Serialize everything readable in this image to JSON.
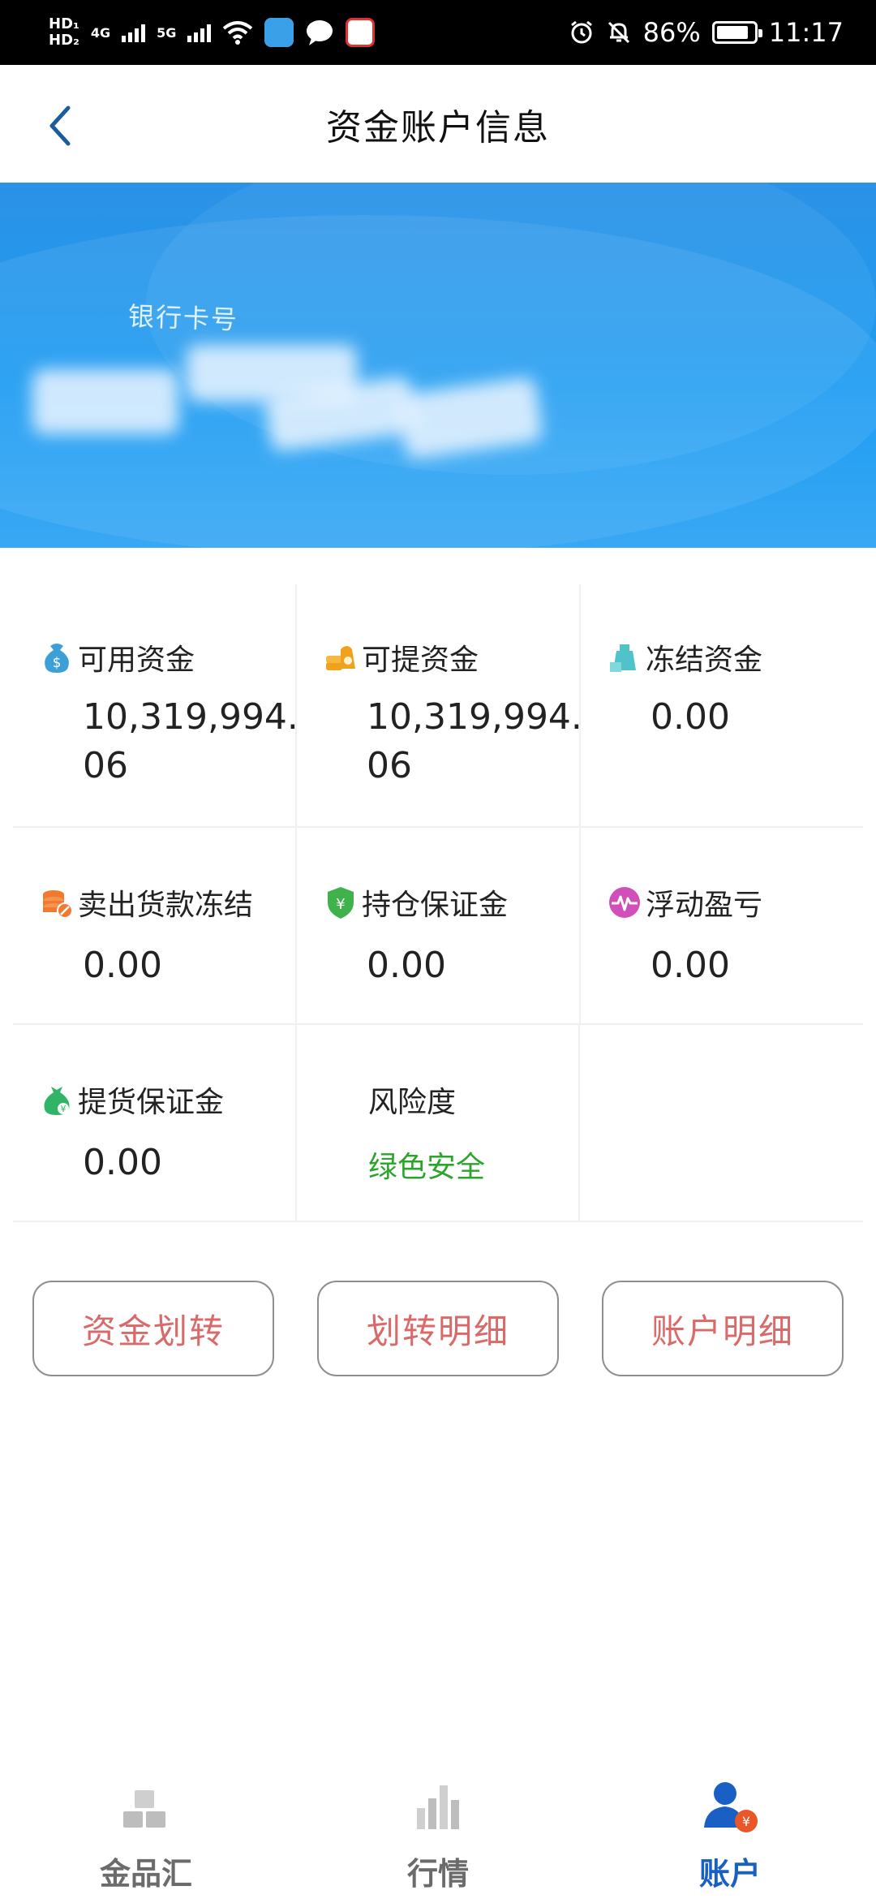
{
  "status_bar": {
    "hd1": "HD₁",
    "hd2": "HD₂",
    "net1": "4G",
    "net2": "5G",
    "battery": "86%",
    "time": "11:17"
  },
  "header": {
    "title": "资金账户信息"
  },
  "banner": {
    "bank_label": "银行卡号"
  },
  "funds": {
    "available": {
      "label": "可用资金",
      "value": "10,319,994.06",
      "icon": "money-bag-icon"
    },
    "withdrawable": {
      "label": "可提资金",
      "value": "10,319,994.06",
      "icon": "gold-coins-icon"
    },
    "frozen": {
      "label": "冻结资金",
      "value": "0.00",
      "icon": "frozen-money-icon"
    },
    "sale_frozen": {
      "label": "卖出货款冻结",
      "value": "0.00",
      "icon": "coin-stack-icon"
    },
    "position_margin": {
      "label": "持仓保证金",
      "value": "0.00",
      "icon": "shield-yen-icon"
    },
    "floating_pl": {
      "label": "浮动盈亏",
      "value": "0.00",
      "icon": "pulse-icon"
    },
    "delivery_margin": {
      "label": "提货保证金",
      "value": "0.00",
      "icon": "delivery-bag-icon"
    },
    "risk": {
      "label": "风险度",
      "value": "绿色安全"
    }
  },
  "actions": {
    "transfer": "资金划转",
    "transfer_details": "划转明细",
    "account_details": "账户明细"
  },
  "tabbar": {
    "items": [
      {
        "label": "金品汇",
        "icon": "gold-bars-icon",
        "active": false
      },
      {
        "label": "行情",
        "icon": "bar-chart-icon",
        "active": false
      },
      {
        "label": "账户",
        "icon": "user-yen-icon",
        "active": true
      }
    ]
  },
  "colors": {
    "banner": "#1d9cf2",
    "risk_safe": "#2aa52a",
    "action_text": "#d86a6a",
    "tab_active": "#1a5fc4"
  }
}
